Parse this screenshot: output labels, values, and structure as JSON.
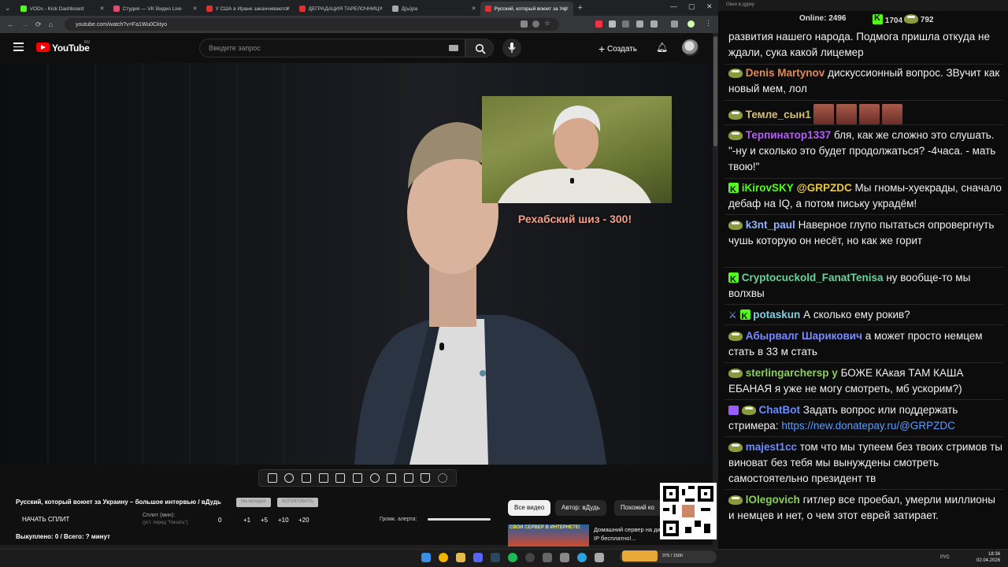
{
  "browser": {
    "tabs": [
      {
        "title": "VODs - Kick Dashboard",
        "color": "#53fc18"
      },
      {
        "title": "Студия — VK Видео Live",
        "color": "#e24a6a"
      },
      {
        "title": "У США в Иране заканчиваются",
        "color": "#e03030"
      },
      {
        "title": "ДЕГРАДАЦИЯ ТАРЕЛОЧНИЦ",
        "color": "#e03030"
      },
      {
        "title": "Д(ы)ра",
        "color": "#aaaaaa"
      },
      {
        "title": "Русский, который воюет за Укр",
        "color": "#e03030"
      }
    ],
    "active_tab": 5,
    "url": "youtube.com/watch?v=Fa1Wu0Cktyo"
  },
  "youtube": {
    "logo_text": "YouTube",
    "region": "RU",
    "search_placeholder": "Введите запрос",
    "create_label": "Создать"
  },
  "video": {
    "caption": "Рехабский шиз - 300!"
  },
  "panel": {
    "title": "Русский, который воюет за Украину – большое интервью / вДудь",
    "btn_new_window": "На вкладке",
    "btn_copy": "КОПИРОВАТЬ",
    "start_split": "НАЧАТЬ СПЛИТ",
    "split_label": "Сплит (мин):",
    "split_sub": "(уст. перед \"Начать\")",
    "split_value": "0",
    "increments": [
      "+1",
      "+5",
      "+10",
      "+20"
    ],
    "alert_label": "Громк. алерта:",
    "bought": "Выкуплено: 0 / Всего: ? минут",
    "chips": [
      "Все видео",
      "Автор: вДудь",
      "Похожий ко"
    ],
    "related_thumb_text": "СВОЙ СЕРВЕР В ИНТЕРНЕТЕ!",
    "related_title": "Домашний сервер на динамическом IP бесплатно!..."
  },
  "chat": {
    "window_title": "Окно в дурку",
    "online_label": "Online:",
    "online_count": "2496",
    "kick_count": "1704",
    "other_count": "792",
    "messages": [
      {
        "user": "",
        "color": "#f0f0f0",
        "badges": [],
        "text": "развития нашего народа. Подмога пришла откуда не ждали, сука какой лицемер"
      },
      {
        "user": "Denis Martynov",
        "color": "#e08a5a",
        "badges": [
          "pepe"
        ],
        "text": "дискуссионный вопрос. ЗВучит как новый мем, лол"
      },
      {
        "user": "Темле_сын1",
        "color": "#d8c070",
        "badges": [
          "pepe"
        ],
        "text": ""
      },
      {
        "user": "Терпинатор1337",
        "color": "#b65cff",
        "badges": [
          "pepe"
        ],
        "text": "бля, как же сложно это слушать. \"-ну и сколько это будет продолжаться? -4часа. - мать твою!\""
      },
      {
        "user": "iKirovSKY",
        "color": "#53fc18",
        "badges": [
          "kick"
        ],
        "mention": "@GRPZDC",
        "text": "Мы гномы-хуекрады, сначало дебаф на IQ, а потом письку украдём!"
      },
      {
        "user": "k3nt_paul",
        "color": "#8ab4ff",
        "badges": [
          "pepe"
        ],
        "text": "Наверное глупо пытаться опровергнуть чушь которую он несёт, но как же горит"
      },
      {
        "user": "Cryptocuckold_FanatTenisa",
        "color": "#6ad0a0",
        "badges": [
          "kick"
        ],
        "text": "ну вообще-то мы волхвы"
      },
      {
        "user": "potaskun",
        "color": "#7ed0e0",
        "badges": [
          "sword",
          "kick"
        ],
        "text": "А сколько ему рокив?"
      },
      {
        "user": "Абырвалг Шарикович",
        "color": "#7a8aff",
        "badges": [
          "pepe"
        ],
        "text": "а может просто немцем стать в 33 м стать"
      },
      {
        "user": "sterlingarchersp y",
        "color": "#8ad05a",
        "badges": [
          "pepe"
        ],
        "text": "БОЖЕ КАкая ТАМ КАША ЕБАНАЯ я уже не могу смотреть, мб ускорим?)"
      },
      {
        "user": "ChatBot",
        "color": "#6a8aff",
        "badges": [
          "bot",
          "pepe"
        ],
        "text": "Задать вопрос или поддержать стримера:",
        "link": "https://new.donatepay.ru/@GRPZDC"
      },
      {
        "user": "majest1cc",
        "color": "#6a8aff",
        "badges": [
          "pepe"
        ],
        "text": "том что мы тупеем без твоих стримов ты виноват без тебя мы вынуждены смотреть самостоятельно президент тв"
      },
      {
        "user": "lOlegovich",
        "color": "#8ad05a",
        "badges": [
          "pepe"
        ],
        "text": "гитлер все проебал, умерли миллионы и немцев и нет, о чем этот еврей затирает."
      }
    ]
  },
  "taskbar": {
    "pill_text": "375 / 1500",
    "lang": "РУС",
    "time": "18:36",
    "date": "02.04.2026"
  }
}
